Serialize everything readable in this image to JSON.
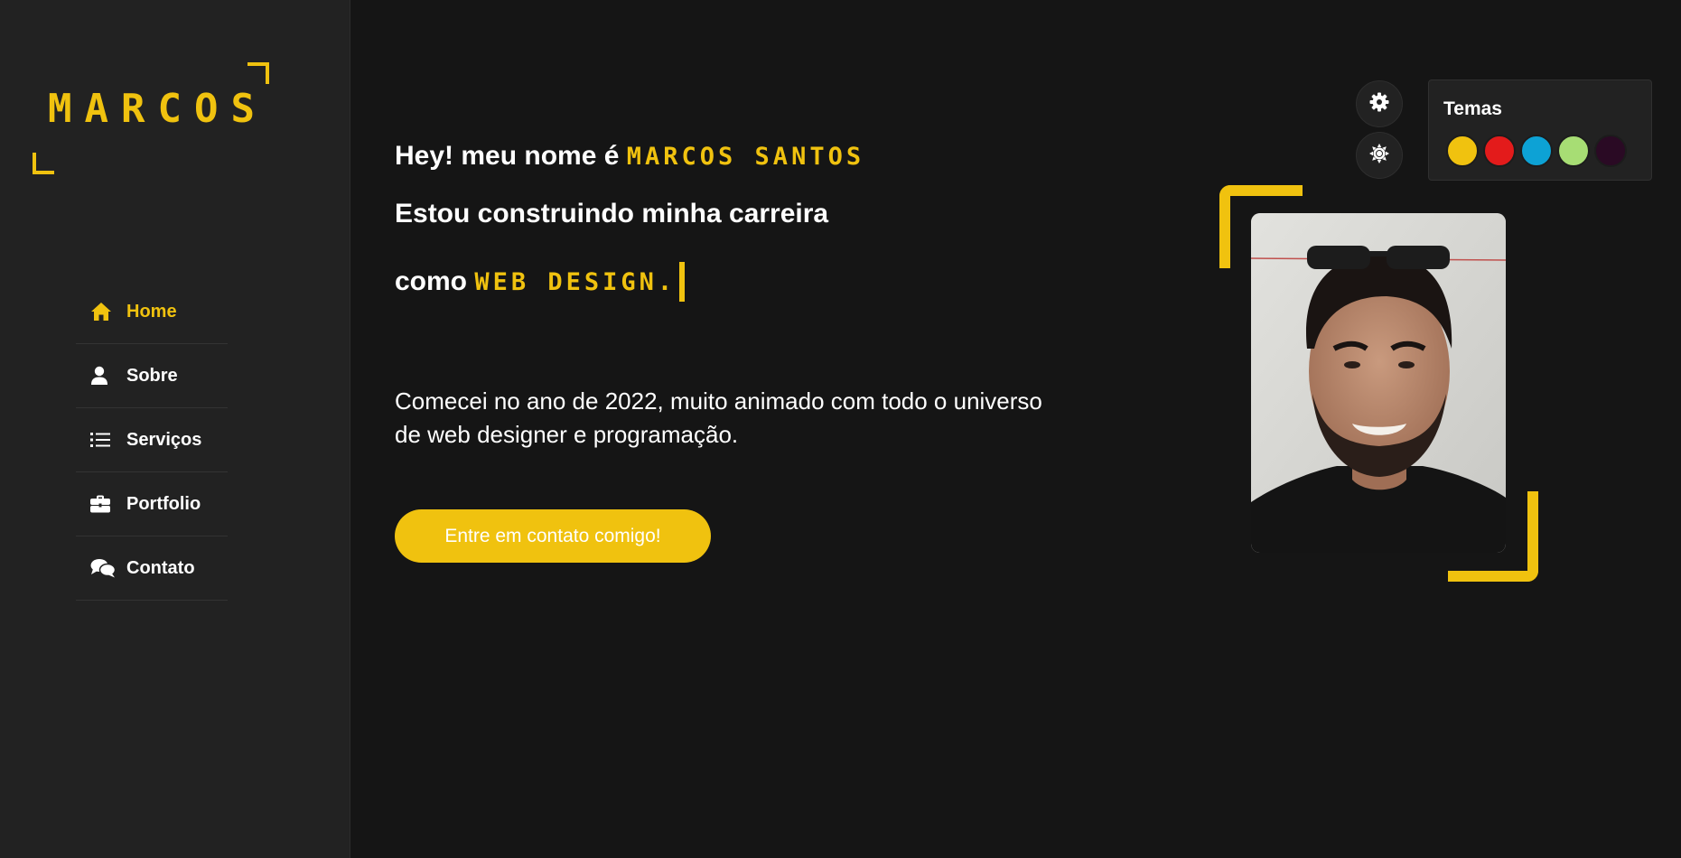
{
  "brand": {
    "logo_text": "MARCOS",
    "accent_color": "#f0c20f",
    "background_color": "#151515",
    "sidebar_color": "#222222"
  },
  "sidebar": {
    "items": [
      {
        "label": "Home",
        "icon": "home-icon",
        "active": true
      },
      {
        "label": "Sobre",
        "icon": "user-icon",
        "active": false
      },
      {
        "label": "Serviços",
        "icon": "list-icon",
        "active": false
      },
      {
        "label": "Portfolio",
        "icon": "briefcase-icon",
        "active": false
      },
      {
        "label": "Contato",
        "icon": "chat-icon",
        "active": false
      }
    ]
  },
  "hero": {
    "greeting": "Hey! meu nome é",
    "name": "MARCOS SANTOS",
    "line2": "Estou construindo minha carreira",
    "line3_prefix": "como",
    "role": "WEB DESIGN."
  },
  "about": {
    "description": "Comecei no ano de 2022, muito animado com todo o universo de web designer e programação."
  },
  "cta": {
    "label": "Entre em contato comigo!"
  },
  "settings": {
    "settings_icon": "gear-icon",
    "mode_icon": "sun-icon"
  },
  "themes": {
    "title": "Temas",
    "colors": [
      "#f0c20f",
      "#e31b1b",
      "#0da2d5",
      "#a7dd74",
      "#2a0a24"
    ]
  },
  "profile_photo": {
    "alt": "profile-photo"
  }
}
